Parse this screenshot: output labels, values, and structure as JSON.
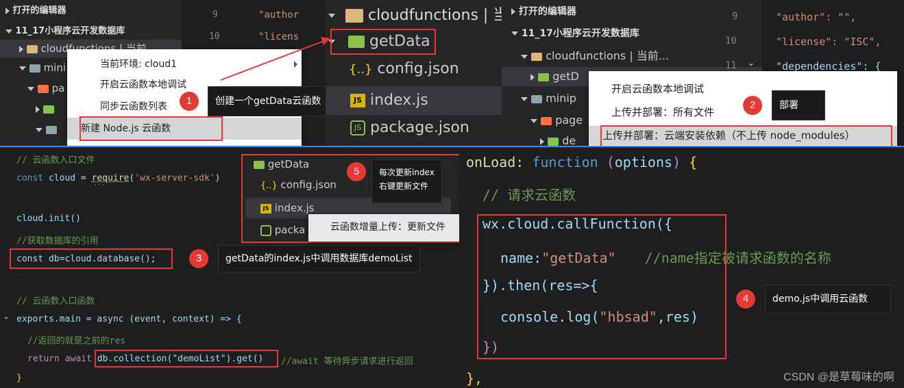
{
  "top_left": {
    "explorer_open_editors": "打开的编辑器",
    "project_title": "11_17小程序云开发数据库",
    "tree_cloudfunctions": "cloudfunctions | 当前...",
    "tree_mini": "mini",
    "tree_pa": "pa",
    "line_numbers": [
      "9",
      "10"
    ],
    "code_author": "\"author",
    "code_license": "\"licens",
    "context_menu": {
      "env": "当前环境: cloud1",
      "debug": "开启云函数本地调试",
      "sync": "同步云函数列表",
      "new_node": "新建 Node.js 云函数"
    },
    "tip1": "创建一个getData云函数"
  },
  "top_mid": {
    "cloudfunctions": "cloudfunctions | 当",
    "getdata": "getData",
    "config": "config.json",
    "index": "index.js",
    "package": "package.json"
  },
  "top_right": {
    "explorer_open_editors": "打开的编辑器",
    "project_title": "11_17小程序云开发数据库",
    "tree_cloudfunctions": "cloudfunctions | 当前...",
    "tree_getd": "getD",
    "tree_minip": "minip",
    "tree_page": "page",
    "tree_de": "de",
    "line_numbers": [
      "9",
      "10",
      "11"
    ],
    "code_author": "\"author\": \"\",",
    "code_license": "\"license\": \"ISC\",",
    "code_dependencies": "\"dependencies\": {",
    "context_menu": {
      "debug": "开启云函数本地调试",
      "deploy_all": "上传并部署：所有文件",
      "deploy_cloud": "上传并部署：云端安装依赖（不上传 node_modules）"
    },
    "tip2": "部署"
  },
  "bottom_left": {
    "comment1": "// 云函数入口文件",
    "line_require": [
      "const",
      "cloud",
      "=",
      "require",
      "(",
      "'wx-server-sdk'",
      ")"
    ],
    "dots": "···",
    "line_init": "cloud.init()",
    "comment2": "//获取数据库的引用",
    "line_db": "const db=cloud.database();",
    "comment3": "// 云函数入口函数",
    "line_exports": "exports.main = async (event, context) => {",
    "comment4": "//返回的就是之前的res",
    "line_return_a": "return await ",
    "line_return_b": "db.collection(\"demoList\").get()",
    "comment5": "//await 等待异步请求进行返回",
    "line_close": "}",
    "tip3": "getData的index.js中调用数据库demoList",
    "popup5": {
      "getdata": "getData",
      "config": "config.json",
      "index": "index.js",
      "packa": "packa",
      "menu": "云函数增量上传：更新文件",
      "tip5_line1": "每次更新index",
      "tip5_line2": "右键更新文件"
    }
  },
  "bottom_right": {
    "line_onload": [
      "onLoad",
      ":",
      "function",
      "(",
      "options",
      ")",
      "{"
    ],
    "comment": "// 请求云函数",
    "line_call": "wx.cloud.callFunction({",
    "line_name_key": "name:",
    "line_name_val": "\"getData\"",
    "line_name_comment": "//name指定被请求函数的名称",
    "line_then": "}).then(res=>{",
    "line_log_a": "console.log(",
    "line_log_b": "\"hbsad\"",
    "line_log_c": ",res)",
    "line_close": "})",
    "line_end": "},",
    "tip4": "demo.js中调用云函数",
    "watermark": "CSDN @是草莓味的啊"
  },
  "badges": [
    "1",
    "2",
    "3",
    "4",
    "5"
  ]
}
